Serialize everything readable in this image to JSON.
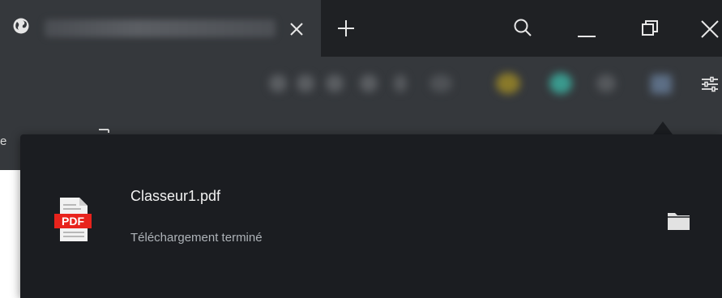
{
  "tab": {
    "title": "",
    "icon": "globe-icon"
  },
  "window_controls": [
    "search-icon",
    "minimize-icon",
    "restore-icon",
    "close-icon"
  ],
  "toolbar": {
    "extensions": [
      "blurred",
      "blurred",
      "blurred",
      "blurred",
      "blurred",
      "blurred",
      "blurred",
      "blurred",
      "blurred"
    ],
    "settings_icon": "sliders-icon",
    "edge_text_left": "e"
  },
  "download": {
    "file_name": "Classeur1.pdf",
    "status": "Téléchargement terminé",
    "file_icon": "pdf-file-icon",
    "file_icon_label": "PDF",
    "action_icon": "folder-icon"
  },
  "colors": {
    "titlebar": "#1f2124",
    "tab_active": "#35383c",
    "panel": "#1b1d21",
    "pdf_red": "#e8231c"
  }
}
